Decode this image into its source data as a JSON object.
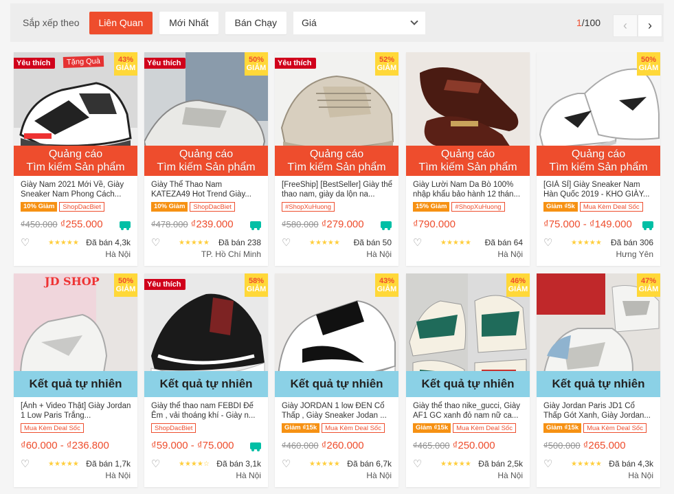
{
  "sortbar": {
    "label": "Sắp xếp theo",
    "options": [
      "Liên Quan",
      "Mới Nhất",
      "Bán Chạy"
    ],
    "active": "Liên Quan",
    "price_label": "Giá"
  },
  "pager": {
    "current": "1",
    "total": "/100"
  },
  "banners": {
    "ad_line1": "Quảng cáo",
    "ad_line2": "Tìm kiếm Sản phẩm",
    "natural": "Kết quả tự nhiên"
  },
  "labels": {
    "favorite": "Yêu thích",
    "gift": "Tặng Quà",
    "discount_word": "GIẢM"
  },
  "colors": {
    "accent": "#ee4d2d",
    "discount_bg": "#ffd839",
    "natural_bg": "#8bd1e6",
    "stars": "#ffce3d"
  },
  "products": [
    {
      "title": "Giày Nam 2021 Mới Về, Giày Sneaker Nam Phong Cách...",
      "fav": true,
      "gift": true,
      "discount": "43%",
      "badges": [
        {
          "text": "10% Giảm",
          "style": "orange"
        },
        {
          "text": "ShopDacBiet",
          "style": "red"
        }
      ],
      "old_price": "₫450.000",
      "price": "₫255.000",
      "free_ship": true,
      "rating": 5,
      "sold": "Đã bán 4,3k",
      "location": "Hà Nội",
      "image": "sneaker-bw"
    },
    {
      "title": "Giày Thể Thao Nam KATEZA49 Hot Trend Giày...",
      "fav": true,
      "gift": false,
      "discount": "50%",
      "badges": [
        {
          "text": "10% Giảm",
          "style": "orange"
        },
        {
          "text": "ShopDacBiet",
          "style": "red"
        }
      ],
      "old_price": "₫478.000",
      "price": "₫239.000",
      "free_ship": true,
      "rating": 5,
      "sold": "Đã bán 238",
      "location": "TP. Hồ Chí Minh",
      "image": "sneaker-grey-jeans"
    },
    {
      "title": "[FreeShip] [BestSeller] Giày thể thao nam, giày da lộn na...",
      "fav": true,
      "gift": false,
      "discount": "52%",
      "badges": [
        {
          "text": "#ShopXuHuong",
          "style": "red"
        }
      ],
      "old_price": "₫580.000",
      "price": "₫279.000",
      "free_ship": true,
      "rating": 5,
      "sold": "Đã bán 50",
      "location": "Hà Nội",
      "image": "sneaker-beige"
    },
    {
      "title": "Giày Lười Nam Da Bò 100% nhập khẩu bảo hành 12 thán...",
      "fav": false,
      "gift": false,
      "discount": "",
      "badges": [
        {
          "text": "15% Giảm",
          "style": "orange"
        },
        {
          "text": "#ShopXuHuong",
          "style": "red"
        }
      ],
      "old_price": "",
      "price": "₫790.000",
      "free_ship": false,
      "rating": 5,
      "sold": "Đã bán 64",
      "location": "Hà Nội",
      "image": "loafer-brown"
    },
    {
      "title": "[GIÁ SỈ] Giày Sneaker Nam Hàn Quốc 2019 - KHO GIÀY...",
      "fav": false,
      "gift": false,
      "discount": "50%",
      "badges": [
        {
          "text": "Giảm ₫5k",
          "style": "orange"
        },
        {
          "text": "Mua Kèm Deal Sốc",
          "style": "red"
        }
      ],
      "old_price": "",
      "price": "₫75.000 - ₫149.000",
      "free_ship": true,
      "rating": 5,
      "sold": "Đã bán 306",
      "location": "Hưng Yên",
      "image": "sneaker-white"
    },
    {
      "title": "[Ảnh + Video Thật] Giày Jordan 1 Low Paris Trắng...",
      "fav": false,
      "gift": false,
      "discount": "50%",
      "badges": [
        {
          "text": "Mua Kèm Deal Sốc",
          "style": "red"
        }
      ],
      "old_price": "",
      "price": "₫60.000 - ₫236.800",
      "free_ship": false,
      "rating": 5,
      "sold": "Đã bán 1,7k",
      "location": "Hà Nội",
      "image": "jordan-pink",
      "shop_overlay": "JD SHOP"
    },
    {
      "title": "Giày thể thao nam FEBDI Đế Êm , vải thoáng khí - Giày n...",
      "fav": true,
      "gift": false,
      "discount": "58%",
      "badges": [
        {
          "text": "ShopDacBiet",
          "style": "red"
        }
      ],
      "old_price": "",
      "price": "₫59.000 - ₫75.000",
      "free_ship": true,
      "rating": 4.5,
      "sold": "Đã bán 3,1k",
      "location": "Hà Nội",
      "image": "sneaker-black"
    },
    {
      "title": "Giày JORDAN 1 low ĐEN Cổ Thấp , Giày Sneaker Jodan ...",
      "fav": false,
      "gift": false,
      "discount": "43%",
      "badges": [
        {
          "text": "Giảm ₫15k",
          "style": "orange"
        },
        {
          "text": "Mua Kèm Deal Sốc",
          "style": "red"
        }
      ],
      "old_price": "₫460.000",
      "price": "₫260.000",
      "free_ship": false,
      "rating": 5,
      "sold": "Đã bán 6,7k",
      "location": "Hà Nội",
      "image": "jordan-black"
    },
    {
      "title": "Giày thể thao nike_gucci, Giày AF1 GC xanh đỏ nam nữ ca...",
      "fav": false,
      "gift": false,
      "discount": "46%",
      "badges": [
        {
          "text": "Giảm ₫15k",
          "style": "orange"
        },
        {
          "text": "Mua Kèm Deal Sốc",
          "style": "red"
        }
      ],
      "old_price": "₫465.000",
      "price": "₫250.000",
      "free_ship": false,
      "rating": 5,
      "sold": "Đã bán 2,5k",
      "location": "Hà Nội",
      "image": "af1-green"
    },
    {
      "title": "Giày Jordan Paris JD1 Cổ Thấp Gót Xanh, Giày Jordan...",
      "fav": false,
      "gift": false,
      "discount": "47%",
      "badges": [
        {
          "text": "Giảm ₫15k",
          "style": "orange"
        },
        {
          "text": "Mua Kèm Deal Sốc",
          "style": "red"
        }
      ],
      "old_price": "₫500.000",
      "price": "₫265.000",
      "free_ship": false,
      "rating": 5,
      "sold": "Đã bán 4,3k",
      "location": "Hà Nội",
      "image": "jordan-blue"
    }
  ]
}
